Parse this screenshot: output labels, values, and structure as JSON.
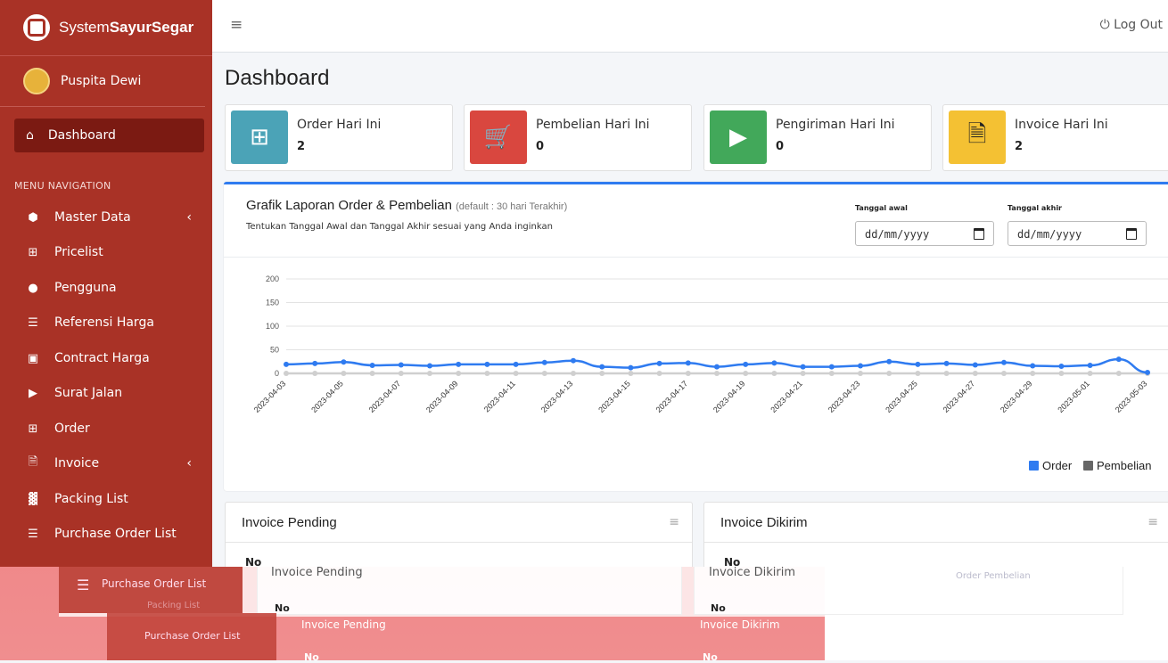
{
  "brand": {
    "pre": "System",
    "bold": "SayurSegar"
  },
  "user": {
    "name": "Puspita Dewi"
  },
  "nav": {
    "active": "Dashboard",
    "header": "MENU NAVIGATION",
    "items": [
      {
        "label": "Master Data",
        "chevron": true
      },
      {
        "label": "Pricelist"
      },
      {
        "label": "Pengguna"
      },
      {
        "label": "Referensi Harga"
      },
      {
        "label": "Contract Harga"
      },
      {
        "label": "Surat Jalan"
      },
      {
        "label": "Order"
      },
      {
        "label": "Invoice",
        "chevron": true
      },
      {
        "label": "Packing List"
      },
      {
        "label": "Purchase Order List"
      }
    ]
  },
  "topbar": {
    "logout": "Log Out"
  },
  "page": {
    "title": "Dashboard"
  },
  "infoboxes": [
    {
      "title": "Order Hari Ini",
      "value": "2",
      "color": "#4ba3b7"
    },
    {
      "title": "Pembelian Hari Ini",
      "value": "0",
      "color": "#d9473f"
    },
    {
      "title": "Pengiriman Hari Ini",
      "value": "0",
      "color": "#42a85a"
    },
    {
      "title": "Invoice Hari Ini",
      "value": "2",
      "color": "#f4c133"
    }
  ],
  "chart_card": {
    "title": "Grafik Laporan Order & Pembelian",
    "title_note": "(default : 30 hari Terakhir)",
    "subtitle": "Tentukan Tanggal Awal dan Tanggal Akhir sesuai yang Anda inginkan",
    "date_start_label": "Tanggal awal",
    "date_end_label": "Tanggal akhir",
    "date_placeholder": "dd/mm/yyyy"
  },
  "chart_data": {
    "type": "line",
    "x": [
      "2023-04-03",
      "2023-04-04",
      "2023-04-05",
      "2023-04-06",
      "2023-04-07",
      "2023-04-08",
      "2023-04-09",
      "2023-04-10",
      "2023-04-11",
      "2023-04-12",
      "2023-04-13",
      "2023-04-14",
      "2023-04-15",
      "2023-04-16",
      "2023-04-17",
      "2023-04-18",
      "2023-04-19",
      "2023-04-20",
      "2023-04-21",
      "2023-04-22",
      "2023-04-23",
      "2023-04-24",
      "2023-04-25",
      "2023-04-26",
      "2023-04-27",
      "2023-04-28",
      "2023-04-29",
      "2023-04-30",
      "2023-05-01",
      "2023-05-02",
      "2023-05-03"
    ],
    "xticks": [
      "2023-04-03",
      "2023-04-05",
      "2023-04-07",
      "2023-04-09",
      "2023-04-11",
      "2023-04-13",
      "2023-04-15",
      "2023-04-17",
      "2023-04-19",
      "2023-04-21",
      "2023-04-23",
      "2023-04-25",
      "2023-04-27",
      "2023-04-29",
      "2023-05-01",
      "2023-05-03"
    ],
    "yticks": [
      0,
      50,
      100,
      150,
      200
    ],
    "ylim": [
      0,
      200
    ],
    "series": [
      {
        "name": "Order",
        "color": "#2f7bf0",
        "values": [
          19,
          21,
          24,
          17,
          18,
          16,
          19,
          19,
          19,
          23,
          27,
          14,
          12,
          21,
          22,
          14,
          19,
          22,
          14,
          14,
          16,
          25,
          19,
          21,
          18,
          23,
          16,
          15,
          17,
          30,
          2
        ]
      },
      {
        "name": "Pembelian",
        "color": "#666666",
        "values": [
          0,
          0,
          0,
          0,
          0,
          0,
          0,
          0,
          0,
          0,
          0,
          0,
          0,
          0,
          0,
          0,
          0,
          0,
          0,
          0,
          0,
          0,
          0,
          0,
          0,
          0,
          0,
          0,
          0,
          0,
          0
        ]
      }
    ],
    "legend": "bottom-right",
    "grid": true
  },
  "cards": [
    {
      "title": "Invoice Pending",
      "col": "No"
    },
    {
      "title": "Invoice Dikirim",
      "col": "No"
    }
  ],
  "ghost": {
    "side1": "Purchase Order List",
    "side1b": "Packing List",
    "side2": "Purchase Order List",
    "card1": "Invoice Pending",
    "card2": "Invoice Dikirim",
    "legend": "Order",
    "legend2": "Pembelian",
    "no": "No"
  }
}
